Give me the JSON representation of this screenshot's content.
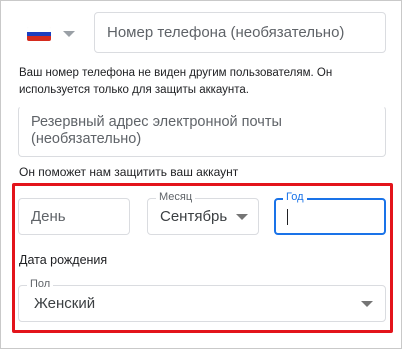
{
  "phone": {
    "country_flag": "russia-flag-icon",
    "placeholder": "Номер телефона (необязательно)",
    "hint": "Ваш номер телефона не виден другим пользователям. Он используется только для защиты аккаунта."
  },
  "recovery_email": {
    "placeholder": "Резервный адрес электронной почты (необязательно)",
    "hint": "Он поможет нам защитить ваш аккаунт"
  },
  "birthday": {
    "day_placeholder": "День",
    "month_label": "Месяц",
    "month_value": "Сентябрь",
    "year_label": "Год",
    "year_value": "",
    "caption": "Дата рождения"
  },
  "gender": {
    "label": "Пол",
    "value": "Женский"
  },
  "colors": {
    "highlight": "#e3141b",
    "focus": "#1a73e8"
  }
}
